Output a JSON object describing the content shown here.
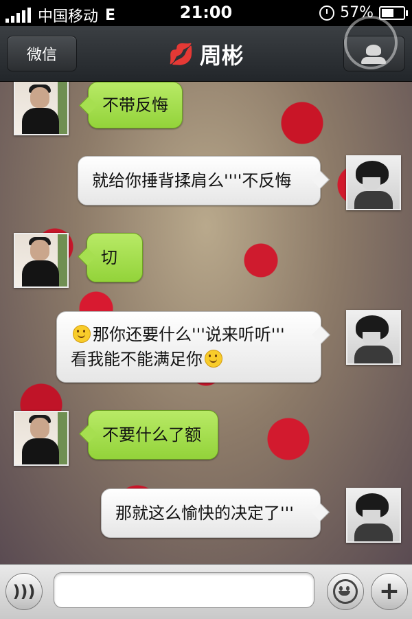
{
  "status_bar": {
    "carrier": "中国移动",
    "network": "E",
    "time": "21:00",
    "battery_percent": "57%",
    "battery_level": 0.57
  },
  "nav": {
    "back_label": "微信",
    "title": "周彬",
    "title_icon": "lips-icon"
  },
  "messages": [
    {
      "side": "friend",
      "text": "不带反悔"
    },
    {
      "side": "me",
      "text": "就给你捶背揉肩么''''不反悔"
    },
    {
      "side": "friend",
      "text": "切"
    },
    {
      "side": "me",
      "line1_text": "那你还要什么'''说来听听'''",
      "line2_text": "看我能不能满足你",
      "icons": [
        "smile-icon",
        "smile-icon"
      ]
    },
    {
      "side": "friend",
      "text": "不要什么了额"
    },
    {
      "side": "me",
      "text": "那就这么愉快的决定了'''"
    }
  ],
  "input_bar": {
    "voice_icon": "voice-icon",
    "message_value": "",
    "emoji_icon": "emoji-icon",
    "plus_icon": "plus-icon"
  },
  "colors": {
    "sent_bubble": "#ffffff",
    "received_bubble": "#a6df50",
    "nav_bar": "#2d3135"
  }
}
